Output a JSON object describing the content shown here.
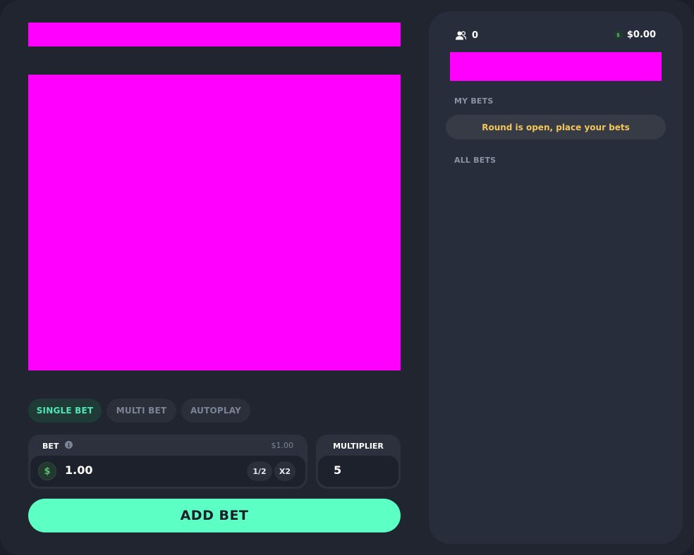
{
  "left": {
    "tabs": [
      {
        "label": "SINGLE BET",
        "active": true
      },
      {
        "label": "MULTI BET",
        "active": false
      },
      {
        "label": "AUTOPLAY",
        "active": false
      }
    ],
    "bet": {
      "label": "BET",
      "max_label": "$1.00",
      "currency_symbol": "$",
      "value": "1.00",
      "half_label": "1/2",
      "double_label": "X2"
    },
    "multiplier": {
      "label": "MULTIPLIER",
      "value": "5"
    },
    "add_bet_label": "ADD BET"
  },
  "side": {
    "players_count": "0",
    "balance": "$0.00",
    "coin_symbol": "$",
    "my_bets_label": "MY BETS",
    "round_status": "Round is open, place your bets",
    "all_bets_label": "ALL BETS"
  },
  "colors": {
    "accent": "#5cffc4",
    "placeholder": "#ff00ff",
    "status_text": "#f3c55a"
  },
  "icons": {
    "players": "users-icon",
    "info": "info-icon",
    "currency": "dollar-coin-icon"
  }
}
